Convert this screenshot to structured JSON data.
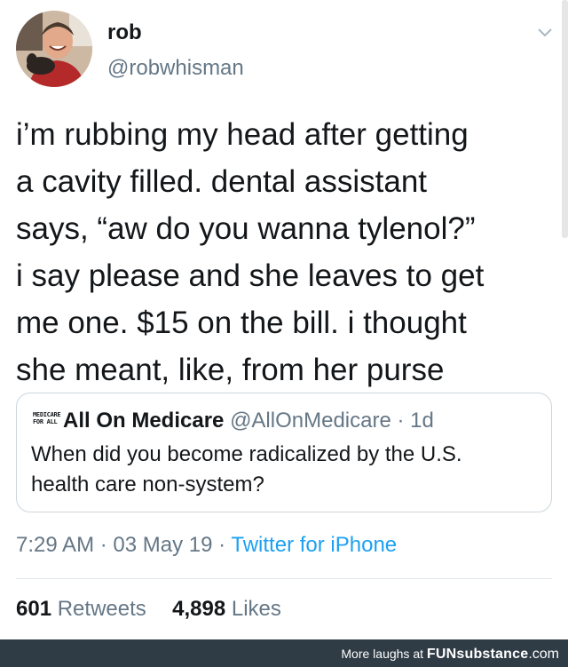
{
  "tweet": {
    "author_name": "rob",
    "author_handle": "@robwhisman",
    "text_lines": [
      "i’m rubbing my head after getting",
      "a cavity filled. dental assistant",
      "says, “aw do you wanna tylenol?”",
      "i say please and she leaves to get",
      "me one. $15 on the bill. i thought",
      "she meant, like, from her purse"
    ],
    "menu_icon": "chevron-down-icon",
    "avatar_icon": "avatar-photo"
  },
  "quoted_tweet": {
    "logo_text": [
      "MEDICARE",
      "FOR ALL"
    ],
    "name": "All On Medicare",
    "handle": "@AllOnMedicare",
    "separator": "·",
    "age": "1d",
    "text_lines": [
      "When did you become radicalized by the U.S.",
      "health care non-system?"
    ]
  },
  "meta": {
    "time": "7:29 AM",
    "separator": "·",
    "date": "03 May 19",
    "source": "Twitter for iPhone"
  },
  "stats": {
    "retweets_count": "601",
    "retweets_label": "Retweets",
    "likes_count": "4,898",
    "likes_label": "Likes"
  },
  "footer": {
    "prefix": "More laughs at",
    "brand_bold": "FUNsubstance",
    "brand_suffix": ".com"
  },
  "colors": {
    "text": "#14171a",
    "secondary": "#657786",
    "link": "#1da1f2",
    "border": "#ccd6dd",
    "footer_bg": "#2f3b45"
  }
}
